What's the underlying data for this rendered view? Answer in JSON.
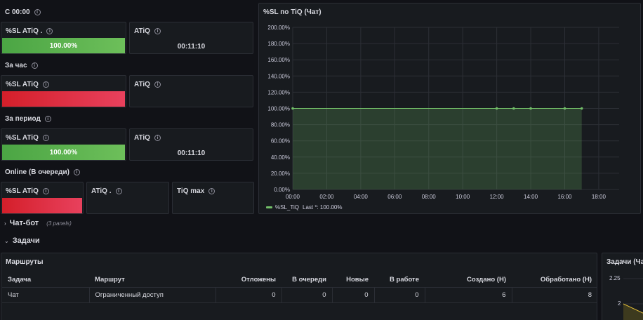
{
  "rows": {
    "row1_title": "С 00:00",
    "row2_title": "За час",
    "row3_title": "За период",
    "row4_title": "Online (В очереди)"
  },
  "panels": {
    "p1_sl": {
      "title": "%SL ATiQ .",
      "value": "100.00%",
      "status": "green"
    },
    "p1_atiq": {
      "title": "ATiQ",
      "value": "00:11:10"
    },
    "p2_sl": {
      "title": "%SL ATiQ",
      "value": "",
      "status": "red"
    },
    "p2_atiq": {
      "title": "ATiQ",
      "value": ""
    },
    "p3_sl": {
      "title": "%SL ATiQ",
      "value": "100.00%",
      "status": "green"
    },
    "p3_atiq": {
      "title": "ATiQ",
      "value": "00:11:10"
    },
    "p4_sl": {
      "title": "%SL ATiQ",
      "value": "",
      "status": "red"
    },
    "p4_atiq": {
      "title": "ATiQ ."
    },
    "p4_tiqmax": {
      "title": "TiQ max"
    }
  },
  "chart_panel": {
    "title": "%SL по TiQ (Чат)",
    "legend_label": "%SL_TiQ",
    "legend_stat": "Last *: 100.00%",
    "series_color": "#73bf69"
  },
  "chart_data": {
    "type": "area",
    "x_ticks": [
      "00:00",
      "02:00",
      "04:00",
      "06:00",
      "08:00",
      "10:00",
      "12:00",
      "14:00",
      "16:00",
      "18:00"
    ],
    "y_ticks": [
      "0.00%",
      "20.00%",
      "40.00%",
      "60.00%",
      "80.00%",
      "100.00%",
      "120.00%",
      "140.00%",
      "160.00%",
      "180.00%",
      "200.00%"
    ],
    "ylim": [
      0,
      200
    ],
    "xlim_hours": [
      0,
      19.2
    ],
    "grid": true,
    "legend_placement": "bottom-left",
    "series": [
      {
        "name": "%SL_TiQ",
        "x_hours": [
          0,
          12,
          13,
          14,
          16,
          17
        ],
        "values": [
          100,
          100,
          100,
          100,
          100,
          100
        ]
      }
    ]
  },
  "collapsed_section": {
    "title": "Чат-бот",
    "sub": "(3 panels)"
  },
  "expanded_section": {
    "title": "Задачи"
  },
  "routes_panel": {
    "title": "Маршруты",
    "columns": [
      "Задача",
      "Маршрут",
      "Отложены",
      "В очереди",
      "Новые",
      "В работе",
      "Создано (Н)",
      "Обработано (Н)"
    ],
    "rows": [
      [
        "Чат",
        "Ограниченный доступ",
        "0",
        "0",
        "0",
        "0",
        "6",
        "8"
      ]
    ]
  },
  "tasks_panel": {
    "title": "Задачи (Ча",
    "y_ticks": [
      "2.25",
      "2"
    ]
  }
}
